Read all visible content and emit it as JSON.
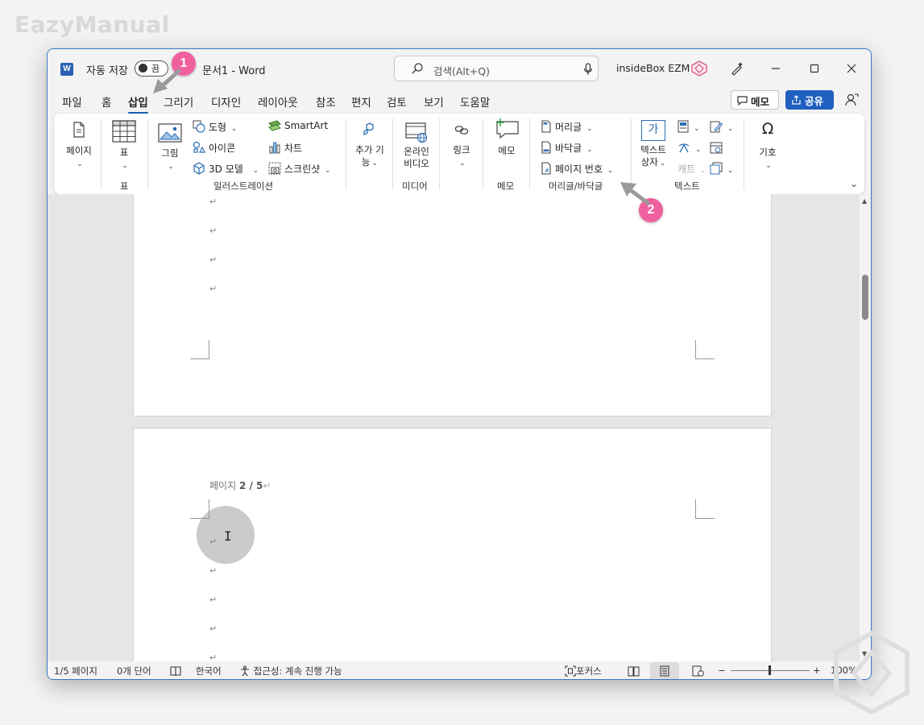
{
  "brand": "EazyManual",
  "titlebar": {
    "autosave_label": "자동 저장",
    "toggle_label": "끔",
    "doc_title": "문서1  -  Word",
    "search_placeholder": "검색(Alt+Q)",
    "user_name": "insideBox EZM"
  },
  "tabs": [
    "파일",
    "홈",
    "삽입",
    "그리기",
    "디자인",
    "레이아웃",
    "참조",
    "편지",
    "검토",
    "보기",
    "도움말"
  ],
  "active_tab": "삽입",
  "header_buttons": {
    "memo": "메모",
    "share": "공유"
  },
  "ribbon": {
    "pages": "페이지",
    "table": "표",
    "table_group": "표",
    "picture": "그림",
    "shapes": "도형",
    "icons": "아이콘",
    "models3d": "3D 모델",
    "smartart": "SmartArt",
    "chart": "차트",
    "screenshot": "스크린샷",
    "illustrations_group": "일러스트레이션",
    "addins_line1": "추가 기",
    "addins_line2": "능",
    "online_video_line1": "온라인",
    "online_video_line2": "비디오",
    "media_group": "미디어",
    "link": "링크",
    "memo": "메모",
    "memo_group": "메모",
    "header": "머리글",
    "footer": "바닥글",
    "page_number": "페이지 번호",
    "header_footer_group": "머리글/바닥글",
    "textbox_line1": "텍스트",
    "textbox_line2": "상자",
    "textbox_glyph": "가",
    "dropcap_disabled": "캐트",
    "text_group": "텍스트",
    "symbols": "기호",
    "symbol_glyph": "Ω"
  },
  "document": {
    "paragraph_mark": "↵",
    "page_header_prefix": "페이지 ",
    "page_header_value": "2 / 5"
  },
  "statusbar": {
    "page": "1/5 페이지",
    "words": "0개 단어",
    "language": "한국어",
    "accessibility": "접근성: 계속 진행 가능",
    "focus": "포커스",
    "zoom_minus": "−",
    "zoom_plus": "+",
    "zoom": "100%"
  },
  "annotations": {
    "badge1": "1",
    "badge2": "2"
  },
  "colors": {
    "accent": "#1f5fbf",
    "badge": "#f0609e",
    "window_border": "#3b78c4"
  }
}
